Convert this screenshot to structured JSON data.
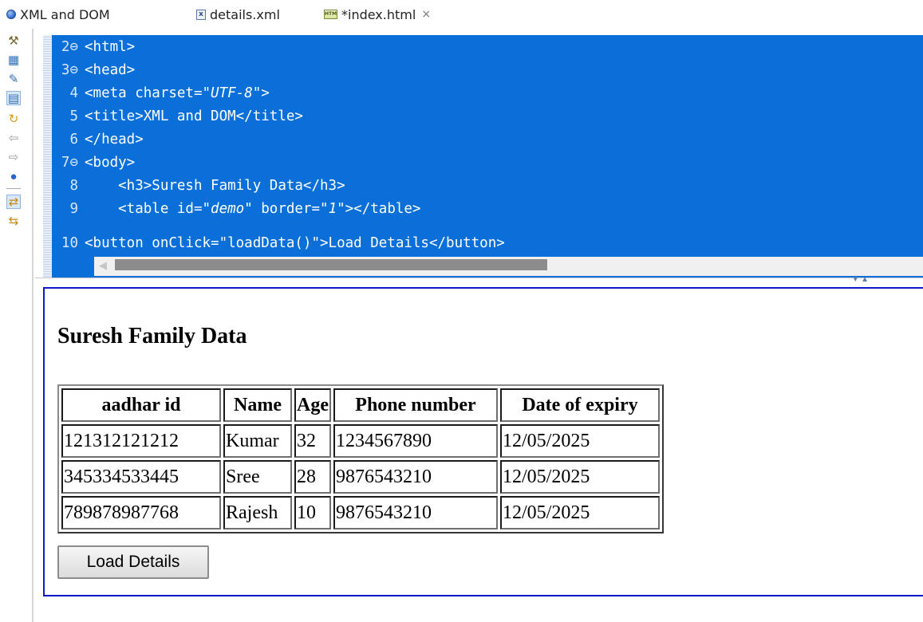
{
  "tabs": [
    {
      "label": "XML and DOM",
      "icon": "globe-icon"
    },
    {
      "label": "details.xml",
      "icon": "xml-file-icon"
    },
    {
      "label": "*index.html",
      "icon": "html-file-icon",
      "close": "×"
    }
  ],
  "toolbar": {
    "icons": [
      "tools-icon",
      "open-browser-icon",
      "edit-icon",
      "preview-icon",
      "refresh-icon",
      "back-arrow-icon",
      "forward-arrow-icon",
      "globe-icon",
      "sync-icon",
      "sync-alt-icon"
    ]
  },
  "editor": {
    "lines": [
      {
        "num": "2",
        "fold": "⊖",
        "text": "<html>"
      },
      {
        "num": "3",
        "fold": "⊖",
        "text": "<head>"
      },
      {
        "num": "4",
        "fold": "",
        "pre": "<meta charset=",
        "italic": "\"UTF-8\"",
        "post": ">"
      },
      {
        "num": "5",
        "fold": "",
        "text": "<title>XML and DOM</title>"
      },
      {
        "num": "6",
        "fold": "",
        "text": "</head>"
      },
      {
        "num": "7",
        "fold": "⊖",
        "text": "<body>"
      },
      {
        "num": "8",
        "fold": "",
        "text": "    <h3>Suresh Family Data</h3>"
      },
      {
        "num": "9",
        "fold": "",
        "pre": "    <table id=",
        "italic": "\"demo\"",
        "mid": " border=",
        "italic2": "\"1\"",
        "post": "></table>"
      },
      {
        "num": "10",
        "fold": "",
        "text": "<button onClick=\"loadData()\">Load Details</button>"
      }
    ]
  },
  "preview": {
    "heading": "Suresh Family Data",
    "table": {
      "headers": [
        "aadhar id",
        "Name",
        "Age",
        "Phone number",
        "Date of expiry"
      ],
      "rows": [
        [
          "121312121212",
          "Kumar",
          "32",
          "1234567890",
          "12/05/2025"
        ],
        [
          "345334533445",
          "Sree",
          "28",
          "9876543210",
          "12/05/2025"
        ],
        [
          "789878987768",
          "Rajesh",
          "10",
          "9876543210",
          "12/05/2025"
        ]
      ]
    },
    "button_label": "Load Details"
  },
  "colors": {
    "selection": "#0a6fd9",
    "preview_border": "#1218c9"
  }
}
